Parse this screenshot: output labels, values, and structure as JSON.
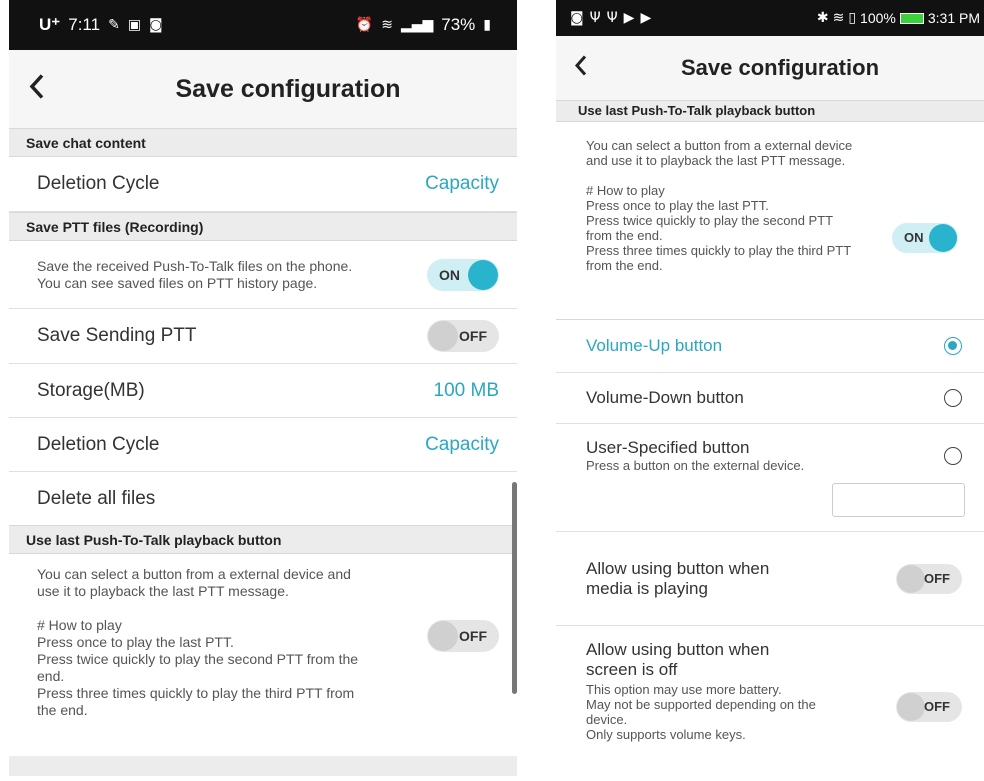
{
  "left": {
    "status": {
      "carrier": "U⁺",
      "time": "7:11",
      "battery_text": "73%",
      "left_icons": [
        "pencil-icon",
        "image-icon",
        "notification-icon"
      ],
      "right_icons": [
        "alarm-icon",
        "wifi-icon",
        "signal-icon",
        "battery-icon"
      ]
    },
    "header": {
      "title": "Save configuration"
    },
    "sections": {
      "chat": {
        "title": "Save chat content",
        "deletion_label": "Deletion Cycle",
        "deletion_value": "Capacity"
      },
      "ptt": {
        "title": "Save PTT files (Recording)",
        "save_desc": "Save the received Push-To-Talk files on the phone. You can see saved files on PTT history page.",
        "save_toggle": "ON",
        "sending_label": "Save Sending PTT",
        "sending_toggle": "OFF",
        "storage_label": "Storage(MB)",
        "storage_value": "100 MB",
        "deletion_label": "Deletion Cycle",
        "deletion_value": "Capacity",
        "delete_all_label": "Delete all files"
      },
      "playback": {
        "title": "Use last Push-To-Talk playback button",
        "desc": "You can select a button from a external device and use it to playback the last PTT message.",
        "howto_title": "# How to play",
        "howto_1": "Press once to play the last PTT.",
        "howto_2": "Press twice quickly to play the second PTT from the end.",
        "howto_3": "Press three times quickly to play the third PTT from the end.",
        "toggle": "OFF"
      }
    }
  },
  "right": {
    "status": {
      "time": "3:31 PM",
      "battery_text": "100%",
      "left_icons": [
        "notification-icon",
        "usb-icon",
        "usb-icon",
        "play-icon",
        "play-icon"
      ],
      "right_icons": [
        "bluetooth-icon",
        "wifi-icon",
        "sim-icon",
        "battery-icon"
      ]
    },
    "header": {
      "title": "Save configuration"
    },
    "playback": {
      "title": "Use last Push-To-Talk playback button",
      "desc": "You can select a button from a external device and use it to playback the last PTT message.",
      "howto_title": "# How to play",
      "howto_1": "Press once to play the last PTT.",
      "howto_2": "Press twice quickly to play the second PTT from the end.",
      "howto_3": "Press three times quickly to play the third PTT from the end.",
      "toggle": "ON"
    },
    "options": {
      "volume_up": "Volume-Up button",
      "volume_down": "Volume-Down button",
      "user_specified": "User-Specified button",
      "user_specified_desc": "Press a button on the external device.",
      "selected": "volume_up"
    },
    "media": {
      "label": "Allow using button when media is playing",
      "toggle": "OFF"
    },
    "screen_off": {
      "label": "Allow using button when screen is off",
      "desc_1": "This option may use more battery.",
      "desc_2": "May not be supported depending on the device.",
      "desc_3": "Only supports volume keys.",
      "toggle": "OFF"
    },
    "colors": {
      "accent": "#2aa7c2",
      "header_bg": "#ececec"
    }
  }
}
